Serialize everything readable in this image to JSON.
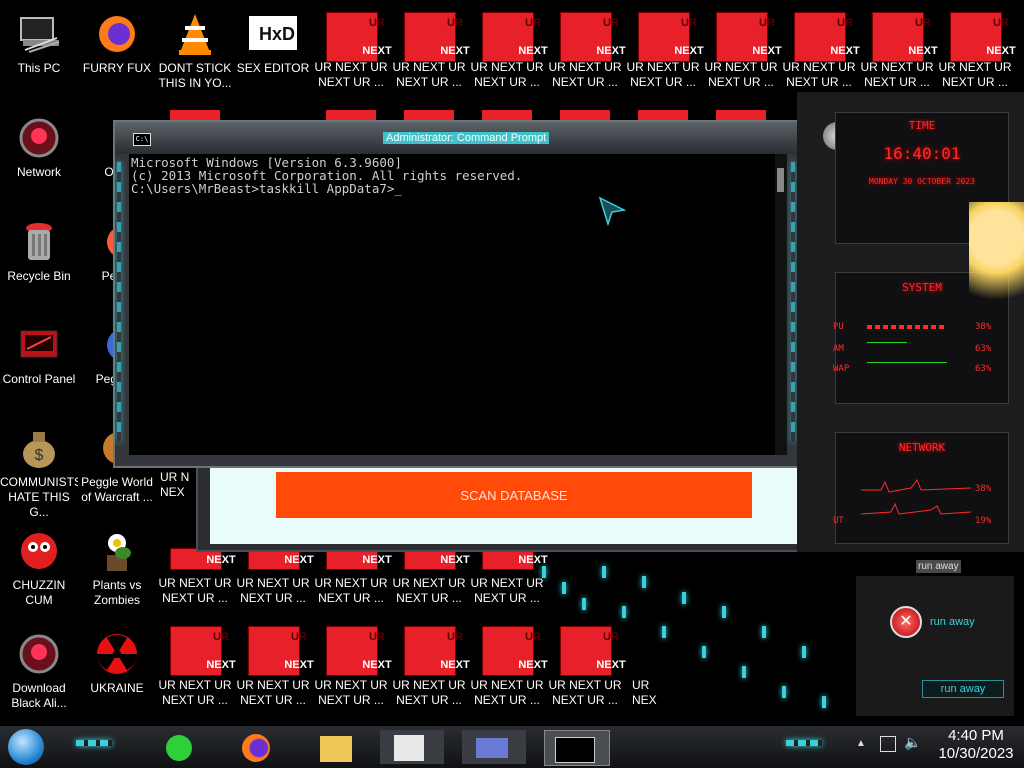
{
  "desktop_icons": [
    {
      "label": "This PC",
      "icon": "this-pc-icon"
    },
    {
      "label": "FURRY FUX",
      "icon": "firefox-icon"
    },
    {
      "label": "DONT STICK THIS IN YO...",
      "icon": "vlc-icon"
    },
    {
      "label": "SEX EDITOR",
      "icon": "hxd-icon"
    },
    {
      "label": "Network",
      "icon": "network-icon"
    },
    {
      "label": "OPE",
      "icon": "file-icon"
    },
    {
      "label": "Recycle Bin",
      "icon": "recycle-bin-icon"
    },
    {
      "label": "Peggl",
      "icon": "peggle-icon"
    },
    {
      "label": "Control Panel",
      "icon": "control-panel-icon"
    },
    {
      "label": "Peggl D",
      "icon": "peggle-icon"
    },
    {
      "label": "COMMUNISTS HATE THIS G...",
      "icon": "money-bag-icon"
    },
    {
      "label": "Peggle World of Warcraft ...",
      "icon": "peggle-icon"
    },
    {
      "label": "CHUZZIN CUM",
      "icon": "chuzzle-icon"
    },
    {
      "label": "Plants vs Zombies",
      "icon": "plants-vs-zombies-icon"
    },
    {
      "label": "Download Black Ali...",
      "icon": "alienware-icon"
    },
    {
      "label": "UKRAINE",
      "icon": "radiation-icon"
    }
  ],
  "ur_icon": {
    "top": "UR",
    "bottom": "NEXT",
    "label": "UR NEXT UR NEXT UR ..."
  },
  "ur_partial": {
    "nex": "NEX",
    "ur_n": "UR N",
    "next": "NEXT",
    "ur_short": "UR",
    "nex2": "NEX"
  },
  "cmd_window": {
    "title": "Administrator: Command Prompt",
    "sys_icon": "C:\\",
    "lines": [
      "Microsoft Windows [Version 6.3.9600]",
      "(c) 2013 Microsoft Corporation. All rights reserved.",
      "",
      "C:\\Users\\MrBeast>taskkill AppData7>_"
    ]
  },
  "scan_window": {
    "button_label": "SCAN DATABASE"
  },
  "rainmeter": {
    "time_header": "TIME",
    "time": "16:40:01",
    "date": "MONDAY 30 OCTOBER 2023",
    "system_header": "SYSTEM",
    "system_rows": [
      {
        "label": "PU",
        "value": "38%"
      },
      {
        "label": "AM",
        "value": "63%"
      },
      {
        "label": "WAP",
        "value": "63%"
      }
    ],
    "network_header": "NETWORK",
    "network_rows": [
      {
        "label": "",
        "value": "38%"
      },
      {
        "label": "UT",
        "value": "19%"
      }
    ]
  },
  "run_away": {
    "title": "run away",
    "message": "run away",
    "button": "run away"
  },
  "taskbar": {
    "apps": [
      "start-orb-icon",
      "notes-icon",
      "firefox-icon",
      "file-explorer-icon",
      "notepad-icon",
      "control-panel-icon",
      "cmd-icon"
    ],
    "time": "4:40 PM",
    "date": "10/30/2023"
  },
  "colors": {
    "accent": "#3ad1dc",
    "alert": "#ff2a2a",
    "scan_button": "#ff4a0a"
  }
}
